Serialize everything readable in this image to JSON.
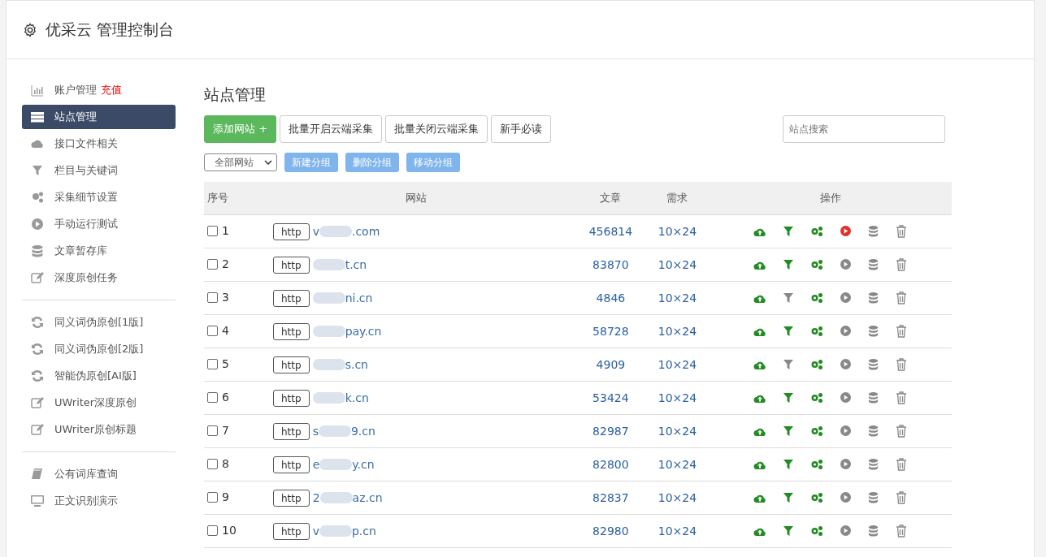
{
  "window": {
    "title": "优采云 管理控制台"
  },
  "sidebar": {
    "groups": [
      {
        "items": [
          {
            "label": "账户管理",
            "badge": "充值",
            "selected": false
          },
          {
            "label": "站点管理",
            "selected": true
          },
          {
            "label": "接口文件相关",
            "selected": false
          },
          {
            "label": "栏目与关键词",
            "selected": false
          },
          {
            "label": "采集细节设置",
            "selected": false
          },
          {
            "label": "手动运行测试",
            "selected": false
          },
          {
            "label": "文章暂存库",
            "selected": false
          },
          {
            "label": "深度原创任务",
            "selected": false
          }
        ]
      },
      {
        "items": [
          {
            "label": "同义词伪原创[1版]",
            "selected": false
          },
          {
            "label": "同义词伪原创[2版]",
            "selected": false
          },
          {
            "label": "智能伪原创[AI版]",
            "selected": false
          },
          {
            "label": "UWriter深度原创",
            "selected": false
          },
          {
            "label": "UWriter原创标题",
            "selected": false
          }
        ]
      },
      {
        "items": [
          {
            "label": "公有词库查询",
            "selected": false
          },
          {
            "label": "正文识别演示",
            "selected": false
          }
        ]
      }
    ]
  },
  "main": {
    "title": "站点管理",
    "toolbar": [
      {
        "label": "添加网站 +",
        "kind": "primary"
      },
      {
        "label": "批量开启云端采集",
        "kind": "default"
      },
      {
        "label": "批量关闭云端采集",
        "kind": "default"
      },
      {
        "label": "新手必读",
        "kind": "default"
      }
    ],
    "search": {
      "placeholder": "站点搜索"
    },
    "group_select": {
      "value": "全部网站"
    },
    "group_buttons": [
      "新建分组",
      "删除分组",
      "移动分组"
    ],
    "table": {
      "columns": [
        "序号",
        "网站",
        "文章",
        "需求",
        "操作"
      ],
      "rows": [
        {
          "checked": false,
          "index": "1",
          "protocol": "http",
          "site_start": "v",
          "site_end": ".com",
          "articles": "456814",
          "demand": "10×24",
          "filter_on": true,
          "running": true
        },
        {
          "checked": false,
          "index": "2",
          "protocol": "http",
          "site_end": "t.cn",
          "articles": "83870",
          "demand": "10×24",
          "filter_on": true,
          "running": false
        },
        {
          "checked": false,
          "index": "3",
          "protocol": "http",
          "site_end": "ni.cn",
          "articles": "4846",
          "demand": "10×24",
          "filter_on": false,
          "running": false
        },
        {
          "checked": false,
          "index": "4",
          "protocol": "http",
          "site_end": "pay.cn",
          "articles": "58728",
          "demand": "10×24",
          "filter_on": true,
          "running": false
        },
        {
          "checked": false,
          "index": "5",
          "protocol": "http",
          "site_end": "s.cn",
          "articles": "4909",
          "demand": "10×24",
          "filter_on": false,
          "running": false
        },
        {
          "checked": false,
          "index": "6",
          "protocol": "http",
          "site_end": "k.cn",
          "articles": "53424",
          "demand": "10×24",
          "filter_on": true,
          "running": false
        },
        {
          "checked": false,
          "index": "7",
          "protocol": "http",
          "site_start": "s",
          "site_end": "9.cn",
          "articles": "82987",
          "demand": "10×24",
          "filter_on": true,
          "running": false
        },
        {
          "checked": false,
          "index": "8",
          "protocol": "http",
          "site_start": "e",
          "site_end": "y.cn",
          "articles": "82800",
          "demand": "10×24",
          "filter_on": true,
          "running": false
        },
        {
          "checked": false,
          "index": "9",
          "protocol": "http",
          "site_start": "2",
          "site_end": "az.cn",
          "articles": "82837",
          "demand": "10×24",
          "filter_on": true,
          "running": false
        },
        {
          "checked": false,
          "index": "10",
          "protocol": "http",
          "site_start": "v",
          "site_end": "p.cn",
          "articles": "82980",
          "demand": "10×24",
          "filter_on": true,
          "running": false
        }
      ]
    }
  }
}
